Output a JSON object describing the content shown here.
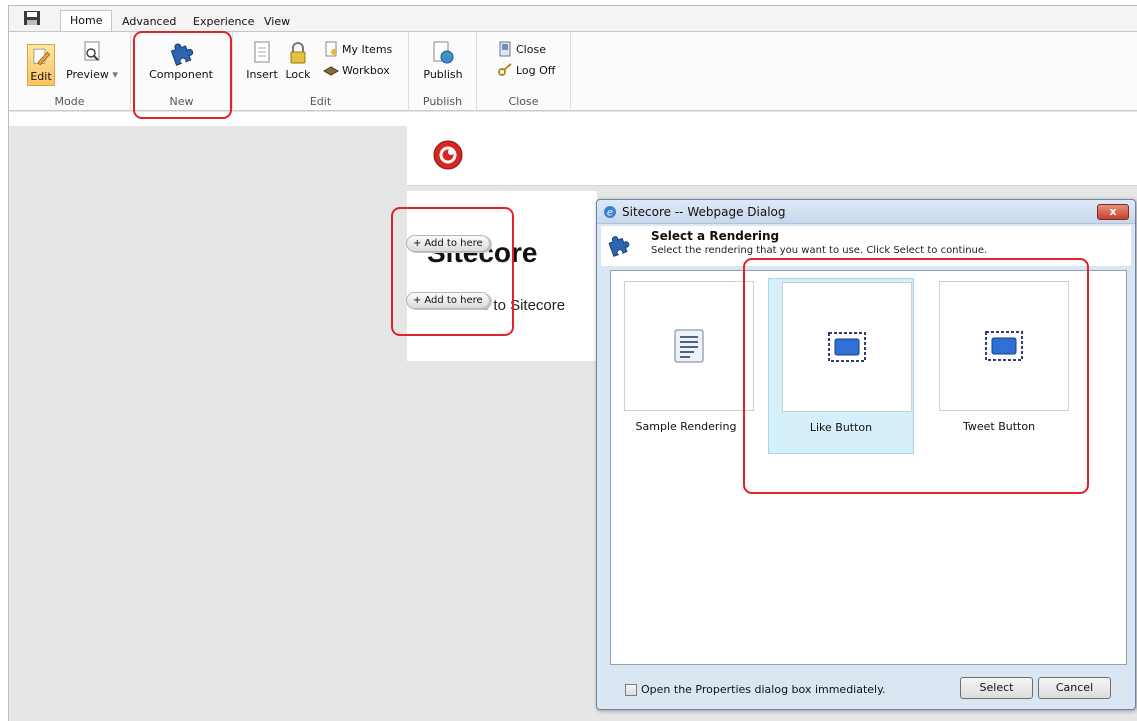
{
  "ribbon": {
    "tabs": [
      "Home",
      "Advanced",
      "Experience",
      "View"
    ],
    "mode": {
      "label": "Mode",
      "edit": "Edit",
      "preview": "Preview"
    },
    "new": {
      "label": "New",
      "component": "Component"
    },
    "edit": {
      "label": "Edit",
      "insert": "Insert",
      "lock": "Lock",
      "my_items": "My Items",
      "workbox": "Workbox"
    },
    "publish": {
      "label": "Publish",
      "publish": "Publish"
    },
    "close": {
      "label": "Close",
      "close": "Close",
      "log_off": "Log Off"
    }
  },
  "page": {
    "title": "Sitecore",
    "welcome": "Welcome to Sitecore",
    "add_here": "Add to here"
  },
  "dialog": {
    "title": "Sitecore -- Webpage Dialog",
    "close_label": "x",
    "heading": "Select a Rendering",
    "subtext": "Select the rendering that you want to use. Click Select to continue.",
    "renderings": [
      {
        "label": "Sample Rendering",
        "icon": "document-lines-icon",
        "selected": false
      },
      {
        "label": "Like Button",
        "icon": "button-placeholder-icon",
        "selected": true
      },
      {
        "label": "Tweet Button",
        "icon": "button-placeholder-icon",
        "selected": false
      }
    ],
    "checkbox_label": "Open the Properties dialog box immediately.",
    "select_button": "Select",
    "cancel_button": "Cancel"
  },
  "colors": {
    "highlight": "#e0232a",
    "selected_bg": "#d5effb",
    "dialog_frame": "#dbe6f3"
  }
}
